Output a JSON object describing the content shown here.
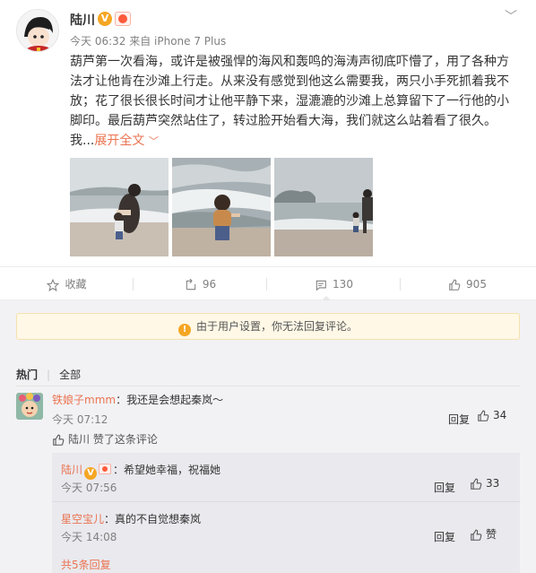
{
  "post": {
    "author": "陆川",
    "verified_mark": "V",
    "meta": "今天 06:32 来自 iPhone 7 Plus",
    "content": "葫芦第一次看海，或许是被强悍的海风和轰鸣的海涛声彻底吓懵了，用了各种方法才让他肯在沙滩上行走。从来没有感觉到他这么需要我，两只小手死抓着我不放；花了很长很长时间才让他平静下来，湿漉漉的沙滩上总算留下了一行他的小脚印。最后葫芦突然站住了，转过脸开始看大海，我们就这么站着看了很久。我...",
    "expand_label": "展开全文",
    "expand_chevron": "﹀",
    "menu_chevron": "﹀",
    "images": [
      "beach-photo-1",
      "beach-photo-2",
      "beach-photo-3"
    ]
  },
  "actions": {
    "favorite": "收藏",
    "repost": "96",
    "comment": "130",
    "like": "905"
  },
  "comments": {
    "notice": "由于用户设置，你无法回复评论。",
    "tabs": {
      "hot": "热门",
      "all": "全部"
    },
    "top_comment": {
      "user": "铁娘子mmm",
      "text": "：我还是会想起秦岚～",
      "time": "今天 07:12",
      "reply_label": "回复",
      "likes": "34",
      "liked_by": "陆川 赞了这条评论"
    },
    "replies": [
      {
        "user": "陆川",
        "text": "：希望她幸福，祝福她",
        "time": "今天 07:56",
        "reply_label": "回复",
        "likes": "33"
      },
      {
        "user": "星空宝儿",
        "text": "：真的不自觉想秦岚",
        "time": "今天 14:08",
        "reply_label": "回复",
        "likes": "赞"
      }
    ],
    "more_replies": "共5条回复"
  },
  "colors": {
    "accent": "#eb7350",
    "muted": "#808080",
    "comment_bg": "#f2f2f5",
    "reply_bg": "#e9e9ee",
    "notice_bg": "#fff8e6"
  }
}
